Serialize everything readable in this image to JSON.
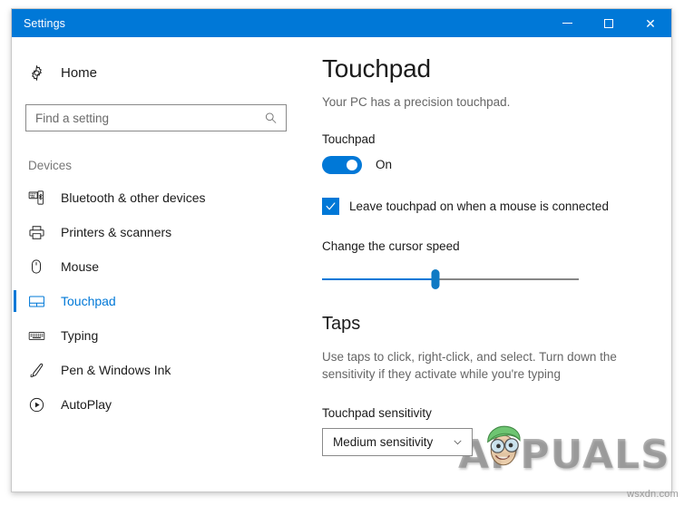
{
  "window": {
    "title": "Settings",
    "accent_color": "#0078d7",
    "controls": {
      "minimize": "Minimize",
      "maximize": "Maximize",
      "close": "Close"
    }
  },
  "sidebar": {
    "home_label": "Home",
    "search": {
      "placeholder": "Find a setting",
      "value": ""
    },
    "section_header": "Devices",
    "items": [
      {
        "label": "Bluetooth & other devices",
        "icon": "bluetooth-devices-icon",
        "selected": false
      },
      {
        "label": "Printers & scanners",
        "icon": "printer-icon",
        "selected": false
      },
      {
        "label": "Mouse",
        "icon": "mouse-icon",
        "selected": false
      },
      {
        "label": "Touchpad",
        "icon": "touchpad-icon",
        "selected": true
      },
      {
        "label": "Typing",
        "icon": "keyboard-icon",
        "selected": false
      },
      {
        "label": "Pen & Windows Ink",
        "icon": "pen-icon",
        "selected": false
      },
      {
        "label": "AutoPlay",
        "icon": "autoplay-icon",
        "selected": false
      }
    ]
  },
  "main": {
    "title": "Touchpad",
    "subtitle": "Your PC has a precision touchpad.",
    "touchpad_toggle": {
      "label": "Touchpad",
      "state_label": "On",
      "on": true
    },
    "leave_on_checkbox": {
      "label": "Leave touchpad on when a mouse is connected",
      "checked": true
    },
    "cursor_speed": {
      "label": "Change the cursor speed",
      "value_percent": 44
    },
    "taps_section": {
      "title": "Taps",
      "description": "Use taps to click, right-click, and select. Turn down the sensitivity if they activate while you're typing",
      "sensitivity_label": "Touchpad sensitivity",
      "sensitivity_value": "Medium sensitivity"
    }
  },
  "watermarks": {
    "brand": "APPUALS",
    "site": "wsxdn.com"
  }
}
